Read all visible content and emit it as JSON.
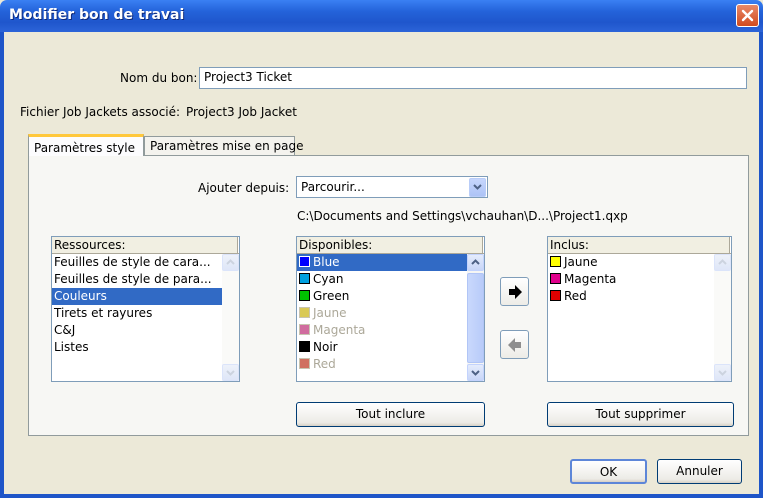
{
  "window": {
    "title": "Modifier bon de travai"
  },
  "form": {
    "ticket_name_label": "Nom du bon:",
    "ticket_name_value": "Project3 Ticket",
    "job_jackets_label": "Fichier Job Jackets associé:",
    "job_jackets_value": "Project3 Job Jacket"
  },
  "tabs": [
    {
      "label": "Paramètres style",
      "active": true
    },
    {
      "label": "Paramètres mise en page",
      "active": false
    }
  ],
  "add_from": {
    "label": "Ajouter depuis:",
    "value": "Parcourir...",
    "path": "C:\\Documents and Settings\\vchauhan\\D...\\Project1.qxp"
  },
  "resources": {
    "header": "Ressources:",
    "items": [
      {
        "label": "Feuilles de style de cara..."
      },
      {
        "label": "Feuilles de style de para..."
      },
      {
        "label": "Couleurs",
        "selected": true
      },
      {
        "label": "Tirets et rayures"
      },
      {
        "label": "C&J"
      },
      {
        "label": "Listes"
      }
    ]
  },
  "available": {
    "header": "Disponibles:",
    "items": [
      {
        "label": "Blue",
        "color": "#0000FF",
        "selected": true,
        "enabled": true
      },
      {
        "label": "Cyan",
        "color": "#00A0E0",
        "enabled": true
      },
      {
        "label": "Green",
        "color": "#00C000",
        "enabled": true
      },
      {
        "label": "Jaune",
        "color": "#D9C955",
        "enabled": false
      },
      {
        "label": "Magenta",
        "color": "#D06C9E",
        "enabled": false
      },
      {
        "label": "Noir",
        "color": "#000000",
        "enabled": true
      },
      {
        "label": "Red",
        "color": "#D07060",
        "enabled": false
      }
    ],
    "include_all_button": "Tout inclure"
  },
  "included": {
    "header": "Inclus:",
    "items": [
      {
        "label": "Jaune",
        "color": "#FFFF00"
      },
      {
        "label": "Magenta",
        "color": "#E0008C"
      },
      {
        "label": "Red",
        "color": "#E00000"
      }
    ],
    "remove_all_button": "Tout supprimer"
  },
  "buttons": {
    "ok": "OK",
    "cancel": "Annuler"
  },
  "icons": {
    "close": "close-icon",
    "add": "arrow-right-icon",
    "remove": "arrow-left-icon",
    "dropdown": "chevron-down-icon"
  }
}
